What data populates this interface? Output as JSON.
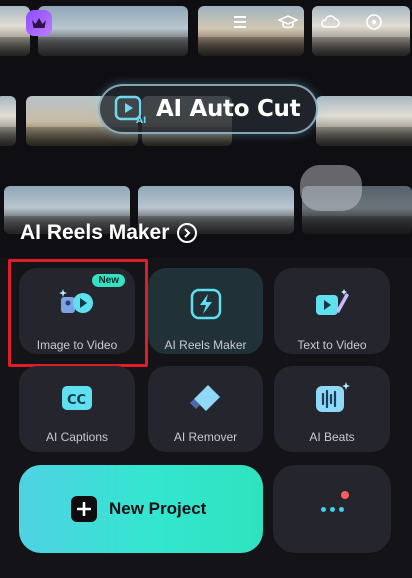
{
  "banner": {
    "feature_label": "AI Auto Cut",
    "section_title": "AI Reels Maker"
  },
  "tools": [
    {
      "label": "Image to Video",
      "badge": "New",
      "icon": "image-to-video-icon"
    },
    {
      "label": "AI Reels Maker",
      "icon": "lightning-icon"
    },
    {
      "label": "Text to Video",
      "icon": "text-to-video-icon"
    },
    {
      "label": "AI Captions",
      "icon": "cc-icon"
    },
    {
      "label": "AI Remover",
      "icon": "eraser-icon"
    },
    {
      "label": "AI Beats",
      "icon": "music-beats-icon"
    }
  ],
  "actions": {
    "new_project_label": "New Project",
    "more_icon": "more-dots-icon"
  },
  "colors": {
    "accent_teal": "#33e6cf",
    "accent_cyan": "#3fd0e8",
    "badge_green": "#35e0c3",
    "highlight_red": "#e01e2a",
    "premium_purple": "#8a4cff",
    "notification_red": "#ff5c5c"
  }
}
